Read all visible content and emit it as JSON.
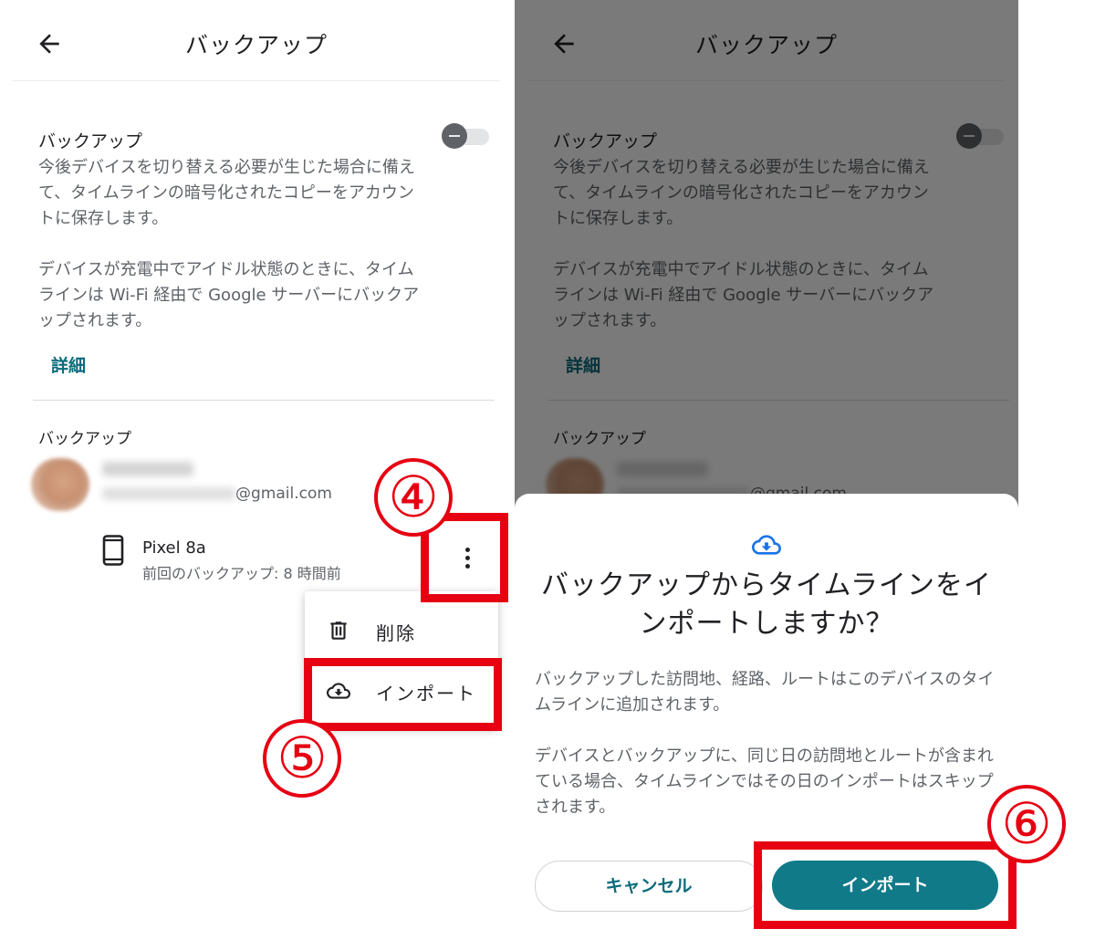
{
  "colors": {
    "accent": "#0b6c7c",
    "primary_button": "#107a89",
    "annotation_red": "#e60012",
    "text_primary": "#202124",
    "text_secondary": "#5f6368"
  },
  "left_screen": {
    "header": {
      "title": "バックアップ",
      "back_icon": "arrow-left-icon"
    },
    "backup_section": {
      "title": "バックアップ",
      "description": "今後デバイスを切り替える必要が生じた場合に備えて、タイムラインの暗号化されたコピーをアカウントに保存します。",
      "note": "デバイスが充電中でアイドル状態のときに、タイムラインは Wi-Fi 経由で Google サーバーにバックアップされます。",
      "details_link": "詳細",
      "toggle_on": false
    },
    "backups_list": {
      "title": "バックアップ",
      "account": {
        "email_domain": "@gmail.com"
      },
      "device": {
        "icon": "smartphone-icon",
        "name": "Pixel 8a",
        "last_backup": "前回のバックアップ: 8 時間前",
        "more_icon": "more-vert-icon"
      }
    },
    "menu": {
      "items": [
        {
          "label": "削除",
          "icon": "trash-icon"
        },
        {
          "label": "インポート",
          "icon": "cloud-download-icon"
        }
      ]
    }
  },
  "right_screen": {
    "dialog": {
      "icon": "cloud-download-icon",
      "title": "バックアップからタイムラインをインポートしますか？",
      "body1": "バックアップした訪問地、経路、ルートはこのデバイスのタイムラインに追加されます。",
      "body2": "デバイスとバックアップに、同じ日の訪問地とルートが含まれている場合、タイムラインではその日のインポートはスキップされます。",
      "cancel_label": "キャンセル",
      "import_label": "インポート"
    }
  },
  "annotations": {
    "step4": "④",
    "step5": "⑤",
    "step6": "⑥"
  }
}
